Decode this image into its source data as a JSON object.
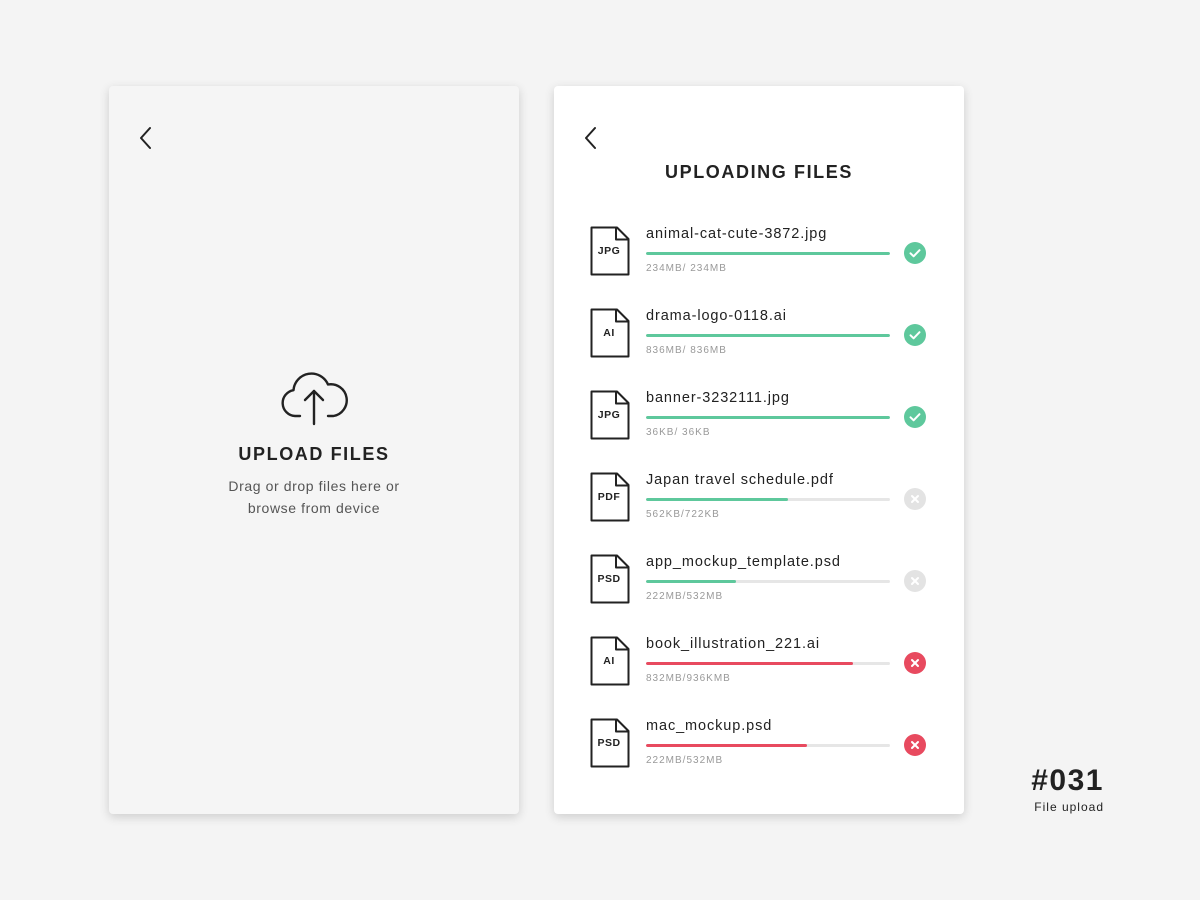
{
  "colors": {
    "background": "#f4f4f4",
    "success": "#5ec89c",
    "error": "#e84a5f",
    "pending": "#e3e3e3",
    "text": "#222222",
    "muted": "#999999"
  },
  "upload_screen": {
    "back_icon": "chevron-left-icon",
    "upload_icon": "cloud-upload-icon",
    "title": "UPLOAD FILES",
    "subtitle": "Drag or drop files here or browse from device"
  },
  "uploading_screen": {
    "back_icon": "chevron-left-icon",
    "title": "UPLOADING FILES",
    "files": [
      {
        "ext": "JPG",
        "name": "animal-cat-cute-3872.jpg",
        "size": "234MB/ 234MB",
        "progress": 1.0,
        "status": "success"
      },
      {
        "ext": "AI",
        "name": "drama-logo-0118.ai",
        "size": "836MB/ 836MB",
        "progress": 1.0,
        "status": "success"
      },
      {
        "ext": "JPG",
        "name": "banner-3232111.jpg",
        "size": "36KB/ 36KB",
        "progress": 1.0,
        "status": "success"
      },
      {
        "ext": "PDF",
        "name": "Japan travel schedule.pdf",
        "size": "562KB/722KB",
        "progress": 0.58,
        "status": "pending"
      },
      {
        "ext": "PSD",
        "name": "app_mockup_template.psd",
        "size": "222MB/532MB",
        "progress": 0.37,
        "status": "pending"
      },
      {
        "ext": "AI",
        "name": "book_illustration_221.ai",
        "size": "832MB/936KMB",
        "progress": 0.85,
        "status": "error"
      },
      {
        "ext": "PSD",
        "name": "mac_mockup.psd",
        "size": "222MB/532MB",
        "progress": 0.66,
        "status": "error"
      }
    ]
  },
  "badge": {
    "number": "#031",
    "label": "File upload"
  }
}
